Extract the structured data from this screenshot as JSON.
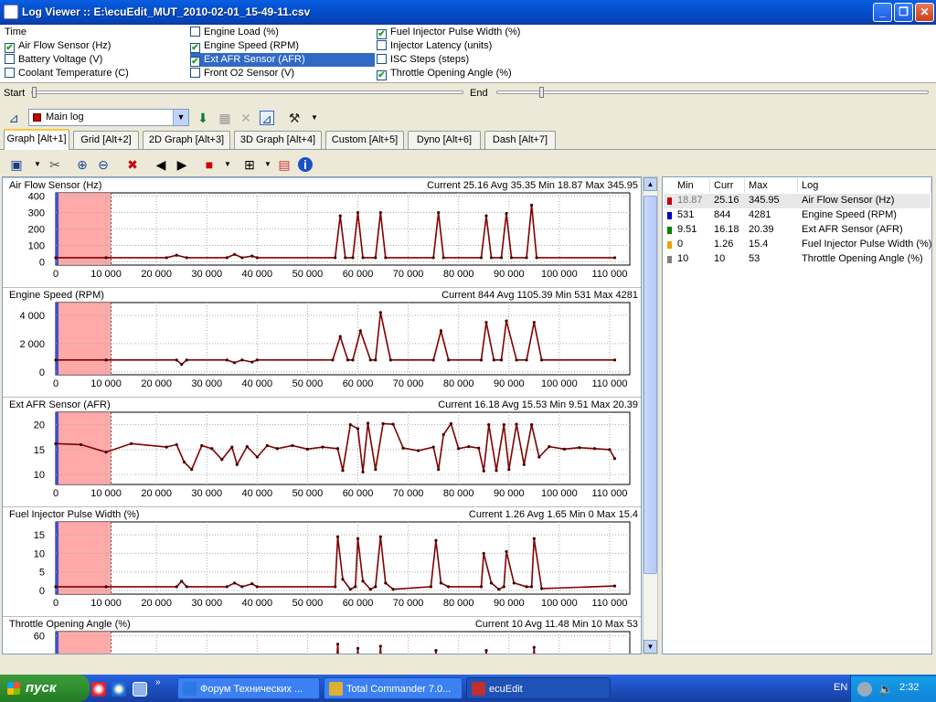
{
  "window": {
    "title": "Log Viewer :: E:\\ecuEdit_MUT_2010-02-01_15-49-11.csv",
    "min": "_",
    "max": "❐",
    "close": "✕"
  },
  "params": [
    {
      "label": "Time",
      "checked": null
    },
    {
      "label": "Air Flow Sensor (Hz)",
      "checked": true
    },
    {
      "label": "Battery Voltage (V)",
      "checked": false
    },
    {
      "label": "Coolant Temperature (C)",
      "checked": false
    },
    {
      "label": "Engine Load (%)",
      "checked": false
    },
    {
      "label": "Engine Speed (RPM)",
      "checked": true
    },
    {
      "label": "Ext AFR Sensor (AFR)",
      "checked": true,
      "selected": true
    },
    {
      "label": "Front O2 Sensor (V)",
      "checked": false
    },
    {
      "label": "Fuel Injector Pulse Width (%)",
      "checked": true
    },
    {
      "label": "Injector Latency (units)",
      "checked": false
    },
    {
      "label": "ISC Steps (steps)",
      "checked": false
    },
    {
      "label": "Throttle Opening Angle (%)",
      "checked": true
    }
  ],
  "range": {
    "start_label": "Start",
    "end_label": "End",
    "start_pos": 0.0,
    "end_pos": 0.1
  },
  "log_select": {
    "value": "Main log"
  },
  "tabs": [
    {
      "label": "Graph [Alt+1]",
      "active": true
    },
    {
      "label": "Grid [Alt+2]"
    },
    {
      "label": "2D Graph [Alt+3]"
    },
    {
      "label": "3D Graph [Alt+4]"
    },
    {
      "label": "Custom [Alt+5]"
    },
    {
      "label": "Dyno [Alt+6]"
    },
    {
      "label": "Dash [Alt+7]"
    }
  ],
  "x_ticks": [
    "0",
    "10 000",
    "20 000",
    "30 000",
    "40 000",
    "50 000",
    "60 000",
    "70 000",
    "80 000",
    "90 000",
    "100 000",
    "110 000"
  ],
  "chart_data": [
    {
      "type": "line",
      "name": "Air Flow Sensor (Hz)",
      "stats": "Current 25.16 Avg 35.35 Min 18.87 Max 345.95",
      "ylim": [
        -20,
        420
      ],
      "yticks": [
        "400",
        "300",
        "200",
        "100",
        "0"
      ],
      "ytick_values": [
        400,
        300,
        200,
        100,
        0
      ],
      "x": [
        0,
        10000,
        22000,
        24000,
        26000,
        34000,
        35500,
        37000,
        39000,
        40000,
        55500,
        56500,
        57500,
        59000,
        60000,
        61000,
        63500,
        64500,
        65500,
        75000,
        76000,
        77000,
        84500,
        85500,
        86500,
        88500,
        89500,
        90500,
        93500,
        94500,
        95500,
        111000
      ],
      "y": [
        25,
        25,
        25,
        40,
        25,
        25,
        45,
        25,
        35,
        25,
        25,
        280,
        25,
        25,
        300,
        25,
        25,
        300,
        25,
        25,
        300,
        25,
        25,
        280,
        25,
        25,
        295,
        25,
        25,
        345,
        25,
        25
      ]
    },
    {
      "type": "line",
      "name": "Engine Speed (RPM)",
      "stats": "Current 844 Avg 1105.39 Min 531 Max 4281",
      "ylim": [
        -200,
        4900
      ],
      "yticks": [
        "4 000",
        "2 000",
        "0"
      ],
      "ytick_values": [
        4000,
        2000,
        0
      ],
      "x": [
        0,
        10000,
        24000,
        25000,
        26000,
        34000,
        35500,
        37000,
        39000,
        40000,
        55000,
        56500,
        58000,
        59000,
        60500,
        62500,
        63500,
        64500,
        66500,
        75000,
        76500,
        78000,
        84500,
        85500,
        87000,
        88500,
        89500,
        91500,
        93500,
        95000,
        96500,
        111000
      ],
      "y": [
        844,
        844,
        844,
        530,
        844,
        844,
        650,
        844,
        700,
        844,
        844,
        2500,
        844,
        844,
        2900,
        844,
        844,
        4200,
        844,
        844,
        2900,
        844,
        844,
        3500,
        844,
        844,
        3600,
        844,
        844,
        3500,
        844,
        844
      ]
    },
    {
      "type": "line",
      "name": "Ext AFR Sensor (AFR)",
      "stats": "Current 16.18 Avg 15.53 Min 9.51 Max 20.39",
      "ylim": [
        8,
        22.5
      ],
      "yticks": [
        "20",
        "15",
        "10"
      ],
      "ytick_values": [
        20,
        15,
        10
      ],
      "x": [
        0,
        5000,
        10000,
        15000,
        22000,
        24000,
        25500,
        27000,
        29000,
        31000,
        33000,
        35000,
        36000,
        38000,
        40000,
        42000,
        44000,
        47000,
        50000,
        53000,
        56000,
        57000,
        58500,
        60000,
        61000,
        62000,
        63500,
        65000,
        67000,
        69000,
        72000,
        75000,
        76000,
        77000,
        78500,
        80000,
        82000,
        84000,
        85000,
        86000,
        87500,
        89000,
        90000,
        91500,
        93000,
        94500,
        96000,
        98000,
        101000,
        104000,
        107000,
        110000,
        111000
      ],
      "y": [
        16.2,
        16,
        14.5,
        16.2,
        15.5,
        16,
        12.5,
        11,
        15.8,
        15.2,
        13,
        15.5,
        12,
        15.6,
        13.5,
        15.8,
        15.2,
        15.8,
        15.1,
        15.5,
        15.2,
        10.8,
        20,
        19.2,
        10.5,
        20.3,
        11,
        20.2,
        20.1,
        15.3,
        14.8,
        15.5,
        11,
        18,
        20.2,
        15.2,
        15.6,
        15.3,
        10.7,
        20,
        10.8,
        20,
        11,
        20.1,
        12,
        20,
        13.5,
        15.6,
        15.1,
        15.4,
        15.2,
        15,
        13.2
      ]
    },
    {
      "type": "line",
      "name": "Fuel Injector Pulse Width (%)",
      "stats": "Current 1.26 Avg 1.65 Min 0 Max 15.4",
      "ylim": [
        -1,
        18.5
      ],
      "yticks": [
        "15",
        "10",
        "5",
        "0"
      ],
      "ytick_values": [
        15,
        10,
        5,
        0
      ],
      "x": [
        0,
        10000,
        24000,
        25000,
        26000,
        34000,
        35500,
        37000,
        39000,
        40000,
        55500,
        56000,
        57000,
        58500,
        59500,
        60000,
        61000,
        62500,
        63500,
        64500,
        65500,
        67000,
        74500,
        75500,
        76500,
        78000,
        84500,
        85000,
        86500,
        88000,
        89000,
        89500,
        91000,
        93500,
        94500,
        95000,
        96500,
        111000
      ],
      "y": [
        1,
        1,
        1,
        2.5,
        1,
        1,
        2,
        1,
        1.8,
        1,
        1,
        14.5,
        3,
        0.3,
        1,
        14,
        2.5,
        0.3,
        1,
        14.5,
        2,
        0.3,
        1,
        13.5,
        2,
        1,
        1,
        10,
        2,
        0.3,
        1,
        10.5,
        2,
        1,
        1,
        14,
        0.5,
        1.2
      ]
    },
    {
      "type": "line",
      "name": "Throttle Opening Angle (%)",
      "stats": "Current 10 Avg 11.48 Min 10 Max 53",
      "ylim": [
        -5,
        64
      ],
      "yticks": [
        "60"
      ],
      "ytick_values": [
        60
      ],
      "x": [
        55500,
        56000,
        56500,
        59500,
        60000,
        60500,
        64000,
        64500,
        65000,
        75000,
        75500,
        76000,
        85000,
        85500,
        86000,
        94500,
        95000,
        95500
      ],
      "y": [
        10,
        52,
        10,
        10,
        48,
        10,
        10,
        50,
        10,
        10,
        46,
        10,
        10,
        46,
        10,
        10,
        49,
        10
      ]
    }
  ],
  "legend": {
    "headers": [
      "Min",
      "Curr",
      "Max",
      "Log"
    ],
    "rows": [
      {
        "color": "#c00000",
        "min": "18.87",
        "curr": "25.16",
        "max": "345.95",
        "log": "Air Flow Sensor (Hz)",
        "selected": true
      },
      {
        "color": "#0000c0",
        "min": "531",
        "curr": "844",
        "max": "4281",
        "log": "Engine Speed (RPM)"
      },
      {
        "color": "#008000",
        "min": "9.51",
        "curr": "16.18",
        "max": "20.39",
        "log": "Ext AFR Sensor (AFR)"
      },
      {
        "color": "#f0a000",
        "min": "0",
        "curr": "1.26",
        "max": "15.4",
        "log": "Fuel Injector Pulse Width (%)"
      },
      {
        "color": "#808080",
        "min": "10",
        "curr": "10",
        "max": "53",
        "log": "Throttle Opening Angle (%)"
      }
    ]
  },
  "taskbar": {
    "start": "пуск",
    "tasks": [
      {
        "label": "Форум Технических ...",
        "color": "#2a7ae2"
      },
      {
        "label": "Total Commander 7.0...",
        "color": "#e0b030"
      },
      {
        "label": "ecuEdit",
        "active": true,
        "color": "#c03030"
      }
    ],
    "lang": "EN",
    "time": "2:32"
  },
  "colors": {
    "line": "#800000",
    "marker": "#400000",
    "highlight": "#ff9a9a"
  }
}
